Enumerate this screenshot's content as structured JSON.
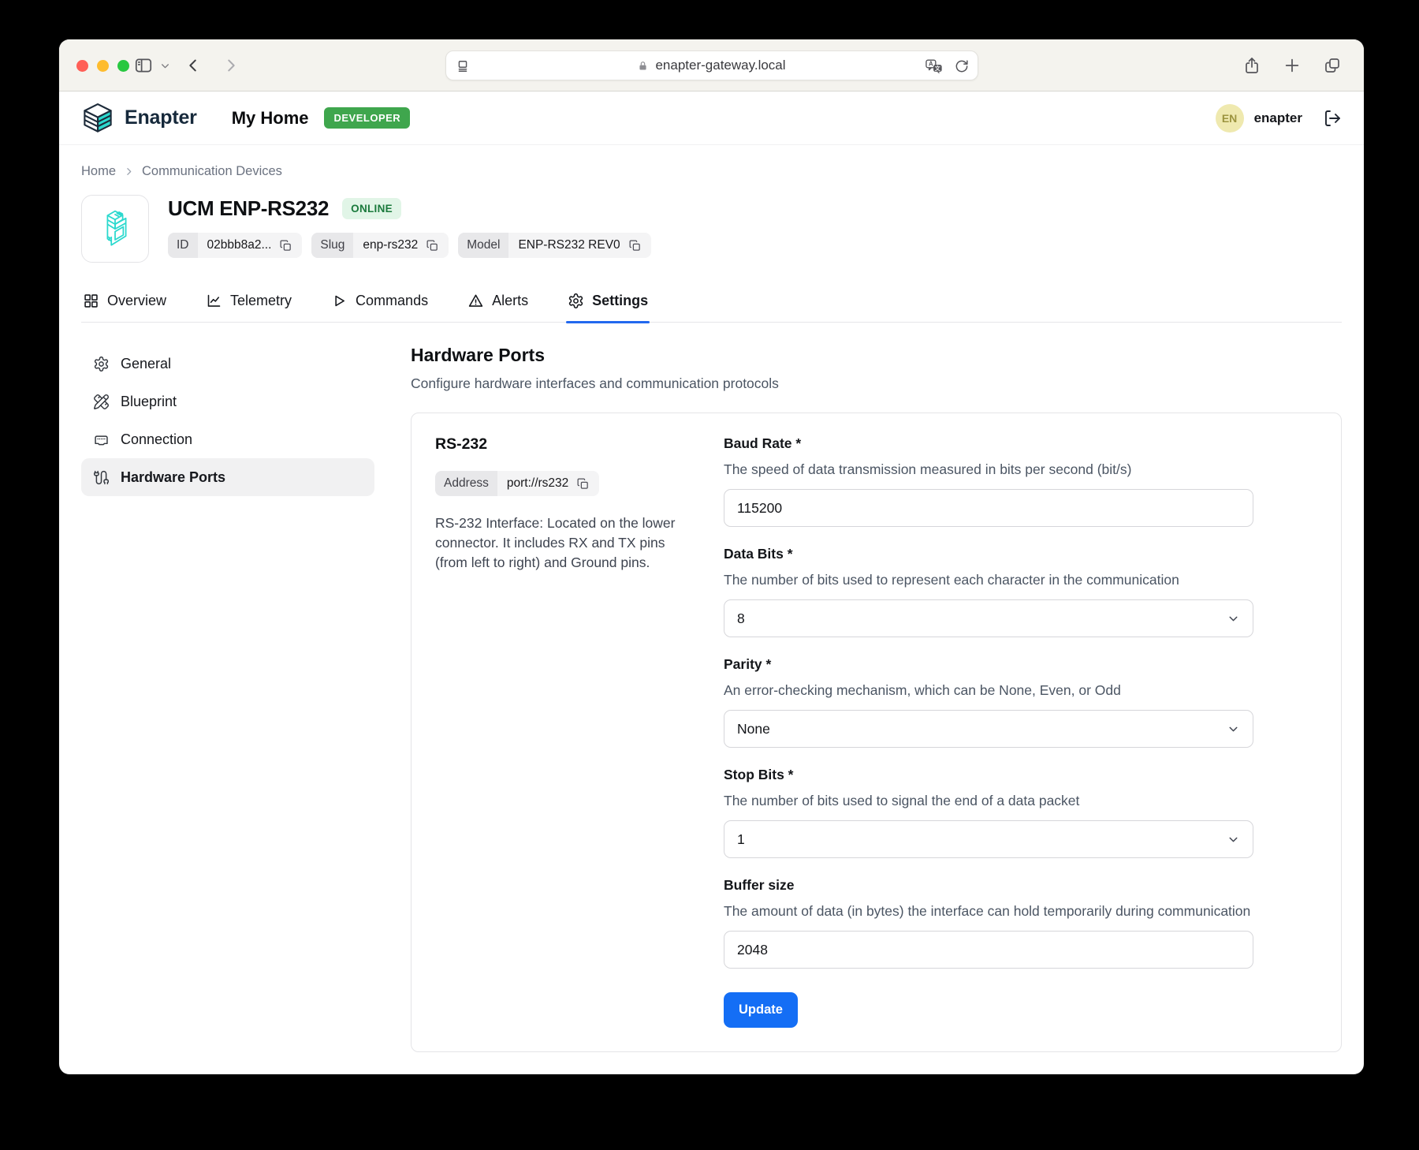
{
  "browser": {
    "address": "enapter-gateway.local"
  },
  "app_header": {
    "brand": "Enapter",
    "site": "My Home",
    "env_badge": "DEVELOPER",
    "user_initials": "EN",
    "user_name": "enapter"
  },
  "breadcrumb": {
    "home": "Home",
    "section": "Communication Devices"
  },
  "device": {
    "name": "UCM ENP-RS232",
    "status": "ONLINE",
    "chips": [
      {
        "label": "ID",
        "value": "02bbb8a2..."
      },
      {
        "label": "Slug",
        "value": "enp-rs232"
      },
      {
        "label": "Model",
        "value": "ENP-RS232 REV0"
      }
    ]
  },
  "tabs": [
    {
      "label": "Overview",
      "active": false
    },
    {
      "label": "Telemetry",
      "active": false
    },
    {
      "label": "Commands",
      "active": false
    },
    {
      "label": "Alerts",
      "active": false
    },
    {
      "label": "Settings",
      "active": true
    }
  ],
  "settings_nav": [
    {
      "label": "General",
      "active": false
    },
    {
      "label": "Blueprint",
      "active": false
    },
    {
      "label": "Connection",
      "active": false
    },
    {
      "label": "Hardware Ports",
      "active": true
    }
  ],
  "content": {
    "title": "Hardware Ports",
    "subtitle": "Configure hardware interfaces and communication protocols",
    "card": {
      "title": "RS-232",
      "address_label": "Address",
      "address_value": "port://rs232",
      "description": "RS-232 Interface: Located on the lower connector. It includes RX and TX pins (from left to right) and Ground pins.",
      "fields": [
        {
          "label": "Baud Rate *",
          "description": "The speed of data transmission measured in bits per second (bit/s)",
          "control": "input",
          "value": "115200"
        },
        {
          "label": "Data Bits *",
          "description": "The number of bits used to represent each character in the communication",
          "control": "select",
          "value": "8"
        },
        {
          "label": "Parity *",
          "description": "An error-checking mechanism, which can be None, Even, or Odd",
          "control": "select",
          "value": "None"
        },
        {
          "label": "Stop Bits *",
          "description": "The number of bits used to signal the end of a data packet",
          "control": "select",
          "value": "1"
        },
        {
          "label": "Buffer size",
          "description": "The amount of data (in bytes) the interface can hold temporarily during communication",
          "control": "input",
          "value": "2048"
        }
      ],
      "submit": "Update"
    }
  },
  "colors": {
    "accent_blue": "#146EF5",
    "brand_teal": "#2BD9CE",
    "brand_navy": "#16293B",
    "badge_green": "#3FA64D",
    "status_online_bg": "#E1F5E7",
    "status_online_text": "#1A7A3C"
  }
}
